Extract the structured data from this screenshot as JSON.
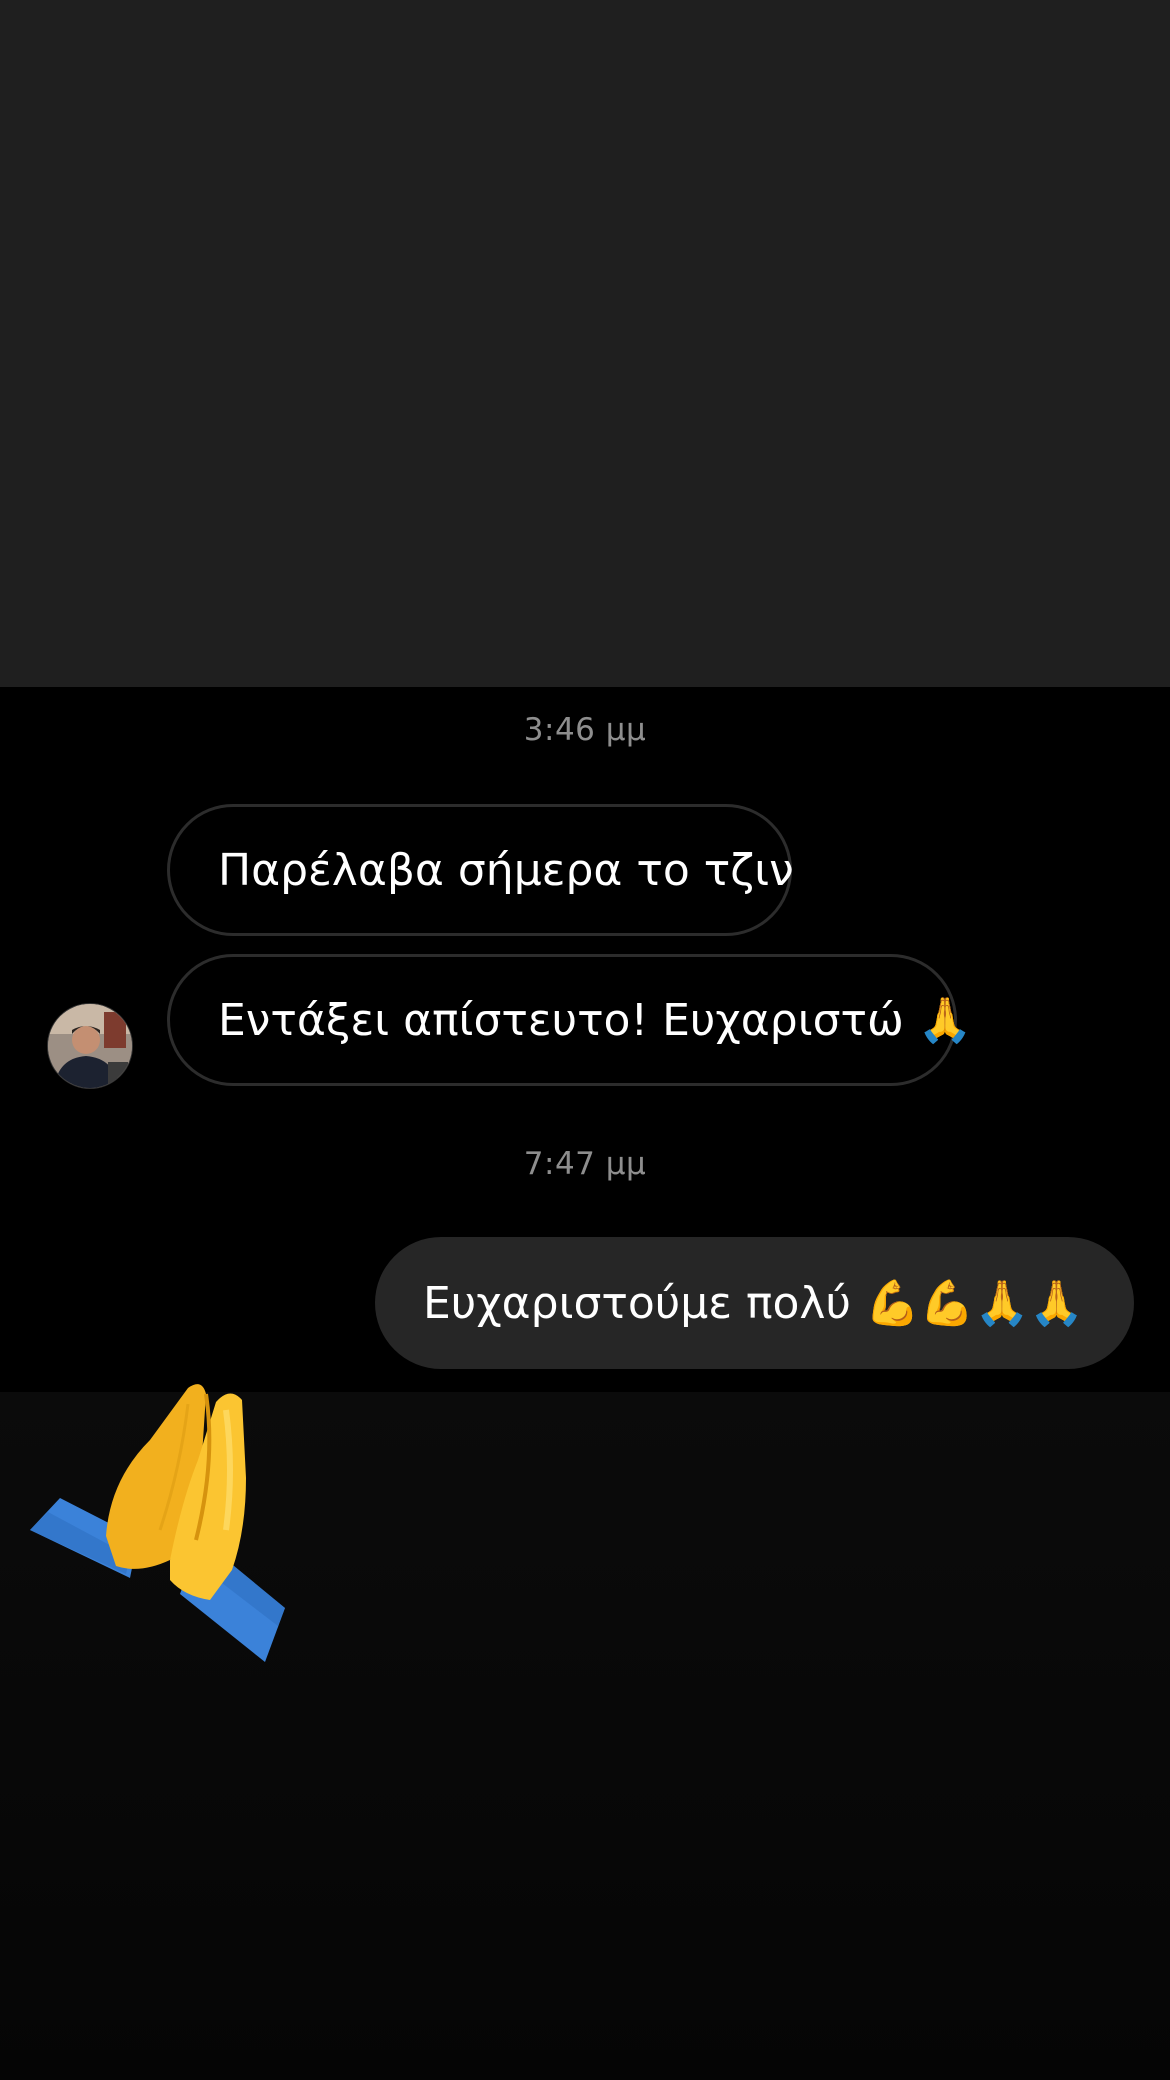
{
  "conversation": {
    "groups": [
      {
        "timestamp": "3:46 μμ",
        "messages": [
          {
            "text": "Παρέλαβα σήμερα το τζιν",
            "emoji": "",
            "direction": "received"
          },
          {
            "text": "Εντάξει απίστευτο! Ευχαριστώ",
            "emoji": "🙏",
            "direction": "received"
          }
        ]
      },
      {
        "timestamp": "7:47 μμ",
        "messages": [
          {
            "text": "Ευχαριστούμε πολύ",
            "emoji": "💪💪🙏🙏",
            "direction": "sent"
          }
        ]
      }
    ]
  },
  "contact": {
    "avatar_icon": "profile-photo"
  },
  "reaction": {
    "icon": "folded-hands-icon",
    "emoji": "🙏"
  },
  "colors": {
    "top_background": "#1f1f1f",
    "chat_background": "#000000",
    "sent_bubble": "#262626",
    "received_border": "#2c2c2c",
    "timestamp_text": "#8e8e8e"
  }
}
